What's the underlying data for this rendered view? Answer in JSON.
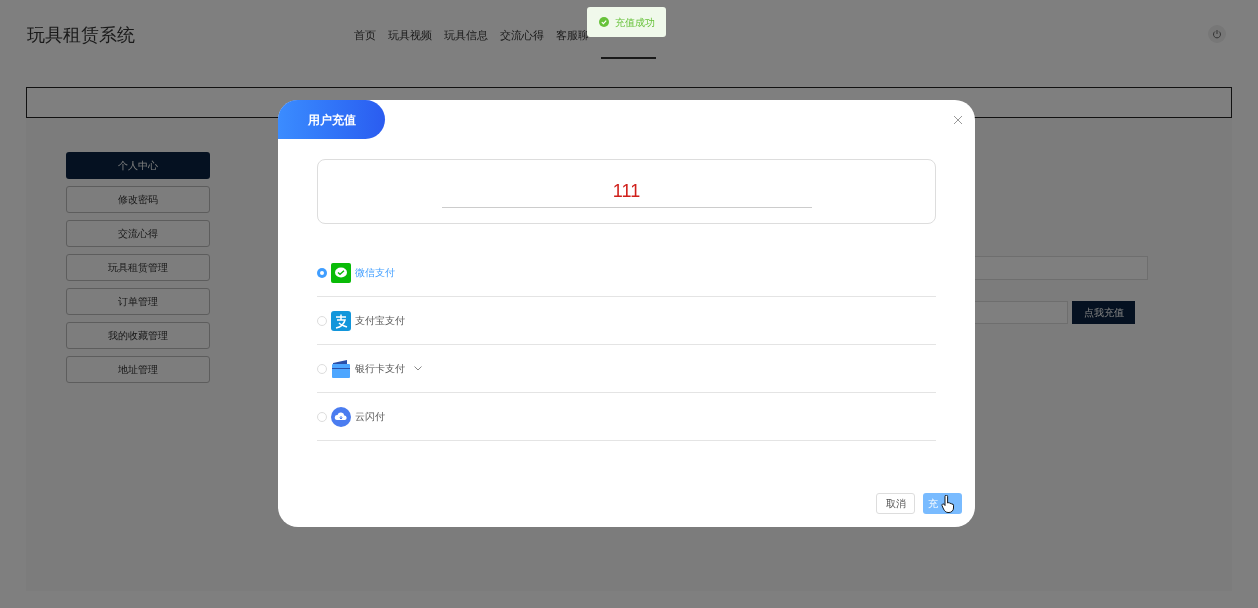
{
  "site_title": "玩具租赁系统",
  "nav": [
    {
      "label": "首页",
      "selected": false
    },
    {
      "label": "玩具视频",
      "selected": false
    },
    {
      "label": "玩具信息",
      "selected": false
    },
    {
      "label": "交流心得",
      "selected": false
    },
    {
      "label": "客服聊",
      "selected": false
    }
  ],
  "sidebar": [
    {
      "label": "个人中心",
      "selected": true
    },
    {
      "label": "修改密码",
      "selected": false
    },
    {
      "label": "交流心得",
      "selected": false
    },
    {
      "label": "玩具租赁管理",
      "selected": false
    },
    {
      "label": "订单管理",
      "selected": false
    },
    {
      "label": "我的收藏管理",
      "selected": false
    },
    {
      "label": "地址管理",
      "selected": false
    }
  ],
  "recharge_button": "点我充值",
  "toast": {
    "text": "充值成功"
  },
  "dialog": {
    "title": "用户充值",
    "amount": "111",
    "methods": [
      {
        "kind": "wechat",
        "label": "微信支付",
        "selected": true
      },
      {
        "kind": "alipay",
        "label": "支付宝支付",
        "selected": false
      },
      {
        "kind": "card",
        "label": "银行卡支付",
        "selected": false,
        "expandable": true
      },
      {
        "kind": "cloud",
        "label": "云闪付",
        "selected": false
      }
    ],
    "cancel": "取消",
    "confirm": "充"
  }
}
